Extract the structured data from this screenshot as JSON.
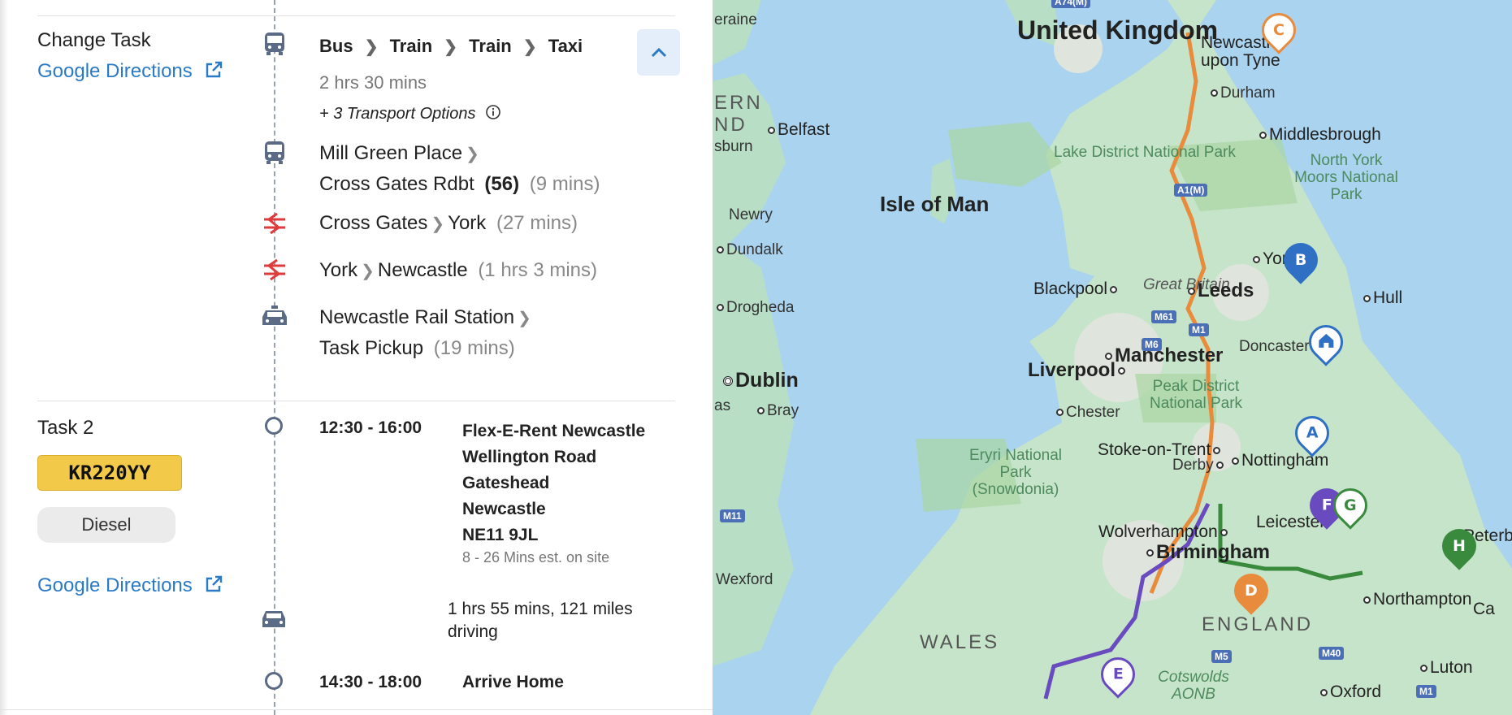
{
  "change_task": {
    "title": "Change Task",
    "directions_link": "Google Directions",
    "modes": [
      "Bus",
      "Train",
      "Train",
      "Taxi"
    ],
    "duration": "2 hrs 30 mins",
    "transport_options": "+ 3 Transport Options",
    "legs": [
      {
        "mode": "bus",
        "from": "Mill Green Place",
        "to": "Cross Gates Rdbt",
        "route": "(56)",
        "time": "(9 mins)"
      },
      {
        "mode": "train",
        "from": "Cross Gates",
        "to": "York",
        "time": "(27 mins)"
      },
      {
        "mode": "train",
        "from": "York",
        "to": "Newcastle",
        "time": "(1 hrs 3 mins)"
      },
      {
        "mode": "taxi",
        "from": "Newcastle Rail Station",
        "to": "Task Pickup",
        "time": "(19 mins)"
      }
    ]
  },
  "task2": {
    "title": "Task 2",
    "plate": "KR220YY",
    "fuel": "Diesel",
    "directions_link": "Google Directions",
    "stop1": {
      "time": "12:30 - 16:00",
      "address": [
        "Flex-E-Rent Newcastle",
        "Wellington Road",
        "Gateshead",
        "Newcastle",
        "NE11 9JL"
      ],
      "onsite": "8 - 26 Mins est. on site"
    },
    "drive": {
      "line1": "1 hrs 55 mins, 121 miles",
      "line2": "driving"
    },
    "stop2": {
      "time": "14:30 - 18:00",
      "name": "Arrive Home"
    }
  },
  "map": {
    "labels": {
      "uk": "United Kingdom",
      "isle_of_man": "Isle of Man",
      "great_britain": "Great Britain",
      "england": "ENGLAND",
      "wales": "WALES",
      "lake_district": "Lake District National Park",
      "north_york": "North York Moors National Park",
      "peak_district": "Peak District National Park",
      "eryri": "Eryri National Park (Snowdonia)",
      "cotswolds": "Cotswolds AONB",
      "newcastle": "Newcastle upon Tyne",
      "durham": "Durham",
      "middlesbrough": "Middlesbrough",
      "york": "York",
      "leeds": "Leeds",
      "hull": "Hull",
      "blackpool": "Blackpool",
      "manchester": "Manchester",
      "doncaster": "Doncaster",
      "liverpool": "Liverpool",
      "chester": "Chester",
      "stoke": "Stoke-on-Trent",
      "derby": "Derby",
      "nottingham": "Nottingham",
      "leicester": "Leicester",
      "wolverhampton": "Wolverhampton",
      "birmingham": "Birmingham",
      "northampton": "Northampton",
      "peterborough": "Peterbo",
      "luton": "Luton",
      "oxford": "Oxford",
      "belfast": "Belfast",
      "newry": "Newry",
      "dundalk": "Dundalk",
      "drogheda": "Drogheda",
      "dublin": "Dublin",
      "bray": "Bray",
      "wexford": "Wexford",
      "ern": "ERN",
      "nd": "ND",
      "eraine": "eraine",
      "sburn": "sburn",
      "as": "as",
      "ca": "Ca"
    },
    "roads": [
      "A74(M)",
      "A1(M)",
      "M61",
      "M6",
      "M1",
      "M11",
      "M5",
      "M40",
      "M1"
    ],
    "pins": {
      "a": "A",
      "b": "B",
      "c": "C",
      "d": "D",
      "e": "E",
      "f": "F",
      "g": "G",
      "h": "H"
    },
    "colors": {
      "orange": "#e88b3c",
      "purple": "#6a4bbf",
      "green": "#3a8a3e",
      "blue": "#2f6fc4"
    }
  }
}
